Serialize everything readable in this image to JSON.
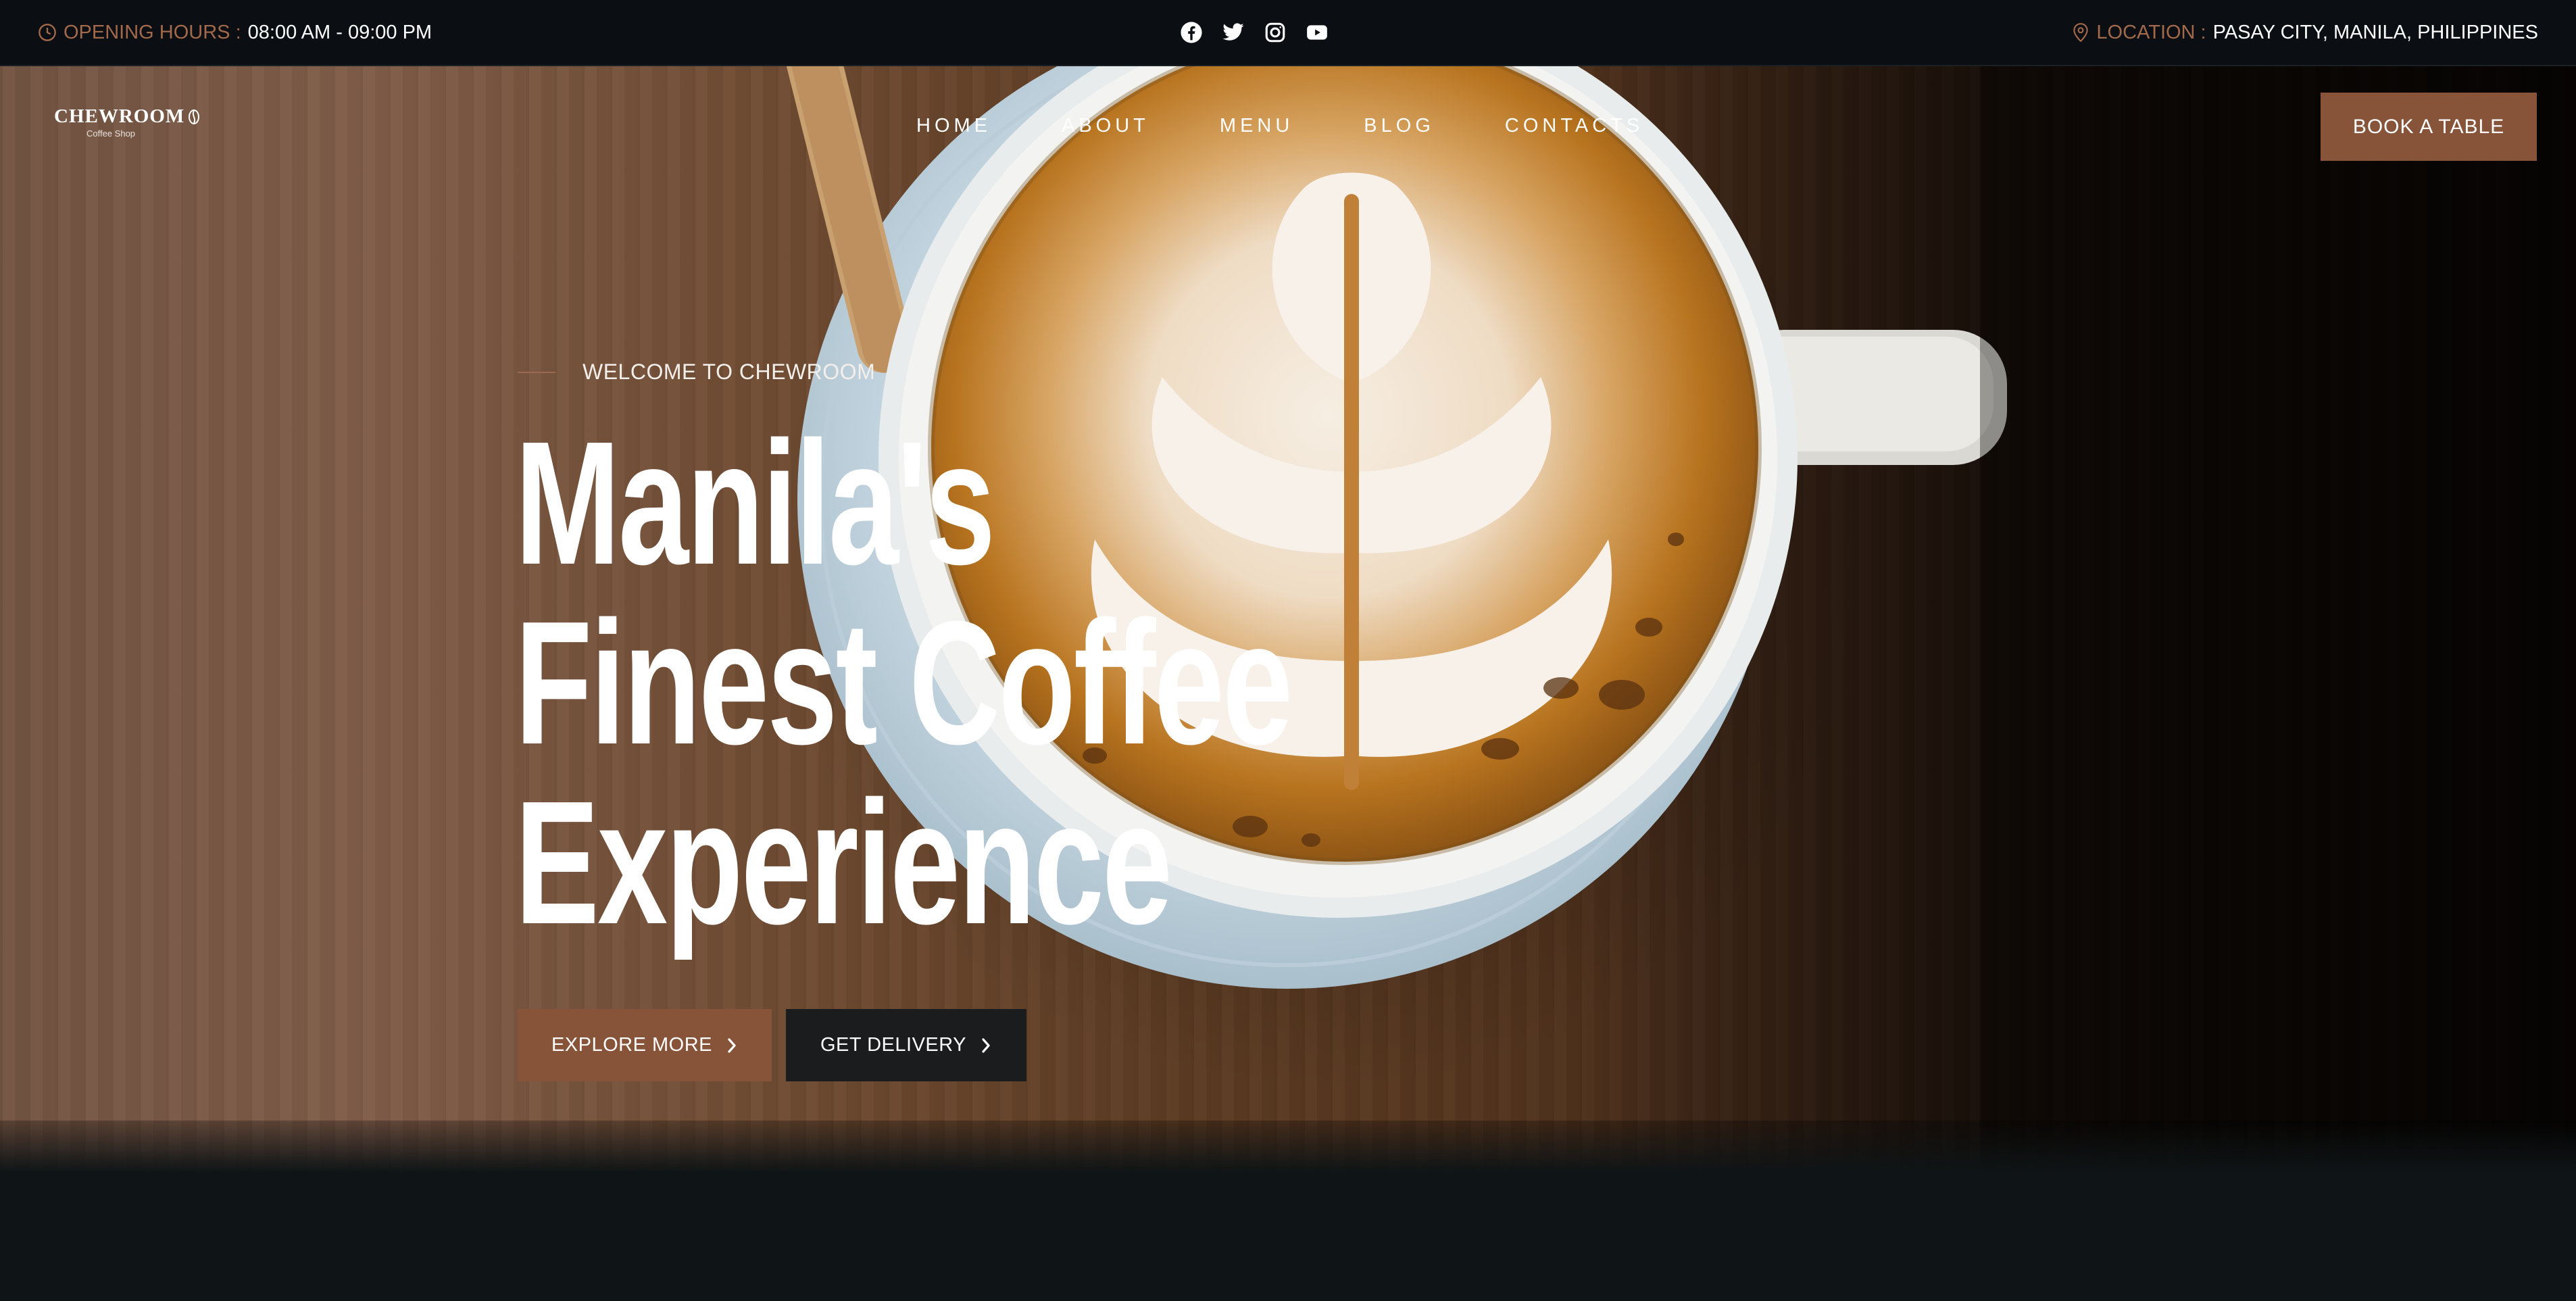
{
  "topbar": {
    "hours_label": "OPENING HOURS :",
    "hours_value": "08:00 AM - 09:00 PM",
    "socials": [
      "facebook-icon",
      "twitter-icon",
      "instagram-icon",
      "youtube-icon"
    ],
    "location_label": "LOCATION :",
    "location_value": "PASAY CITY, MANILA, PHILIPPINES"
  },
  "brand": {
    "name": "CHEWROOM",
    "tagline": "Coffee Shop"
  },
  "nav": {
    "items": [
      "HOME",
      "ABOUT",
      "MENU",
      "BLOG",
      "CONTACTS"
    ],
    "cta": "BOOK A TABLE"
  },
  "hero": {
    "eyebrow": "WELCOME TO CHEWROOM",
    "headline_lines": [
      "Manila's",
      "Finest Coffee",
      "Experience"
    ],
    "primary_button": "EXPLORE MORE",
    "secondary_button": "GET DELIVERY"
  },
  "colors": {
    "accent": "#87543a",
    "topbar_bg": "#0b0f13",
    "dark_button": "#1b1c1e",
    "label_brown": "#a2694a"
  }
}
